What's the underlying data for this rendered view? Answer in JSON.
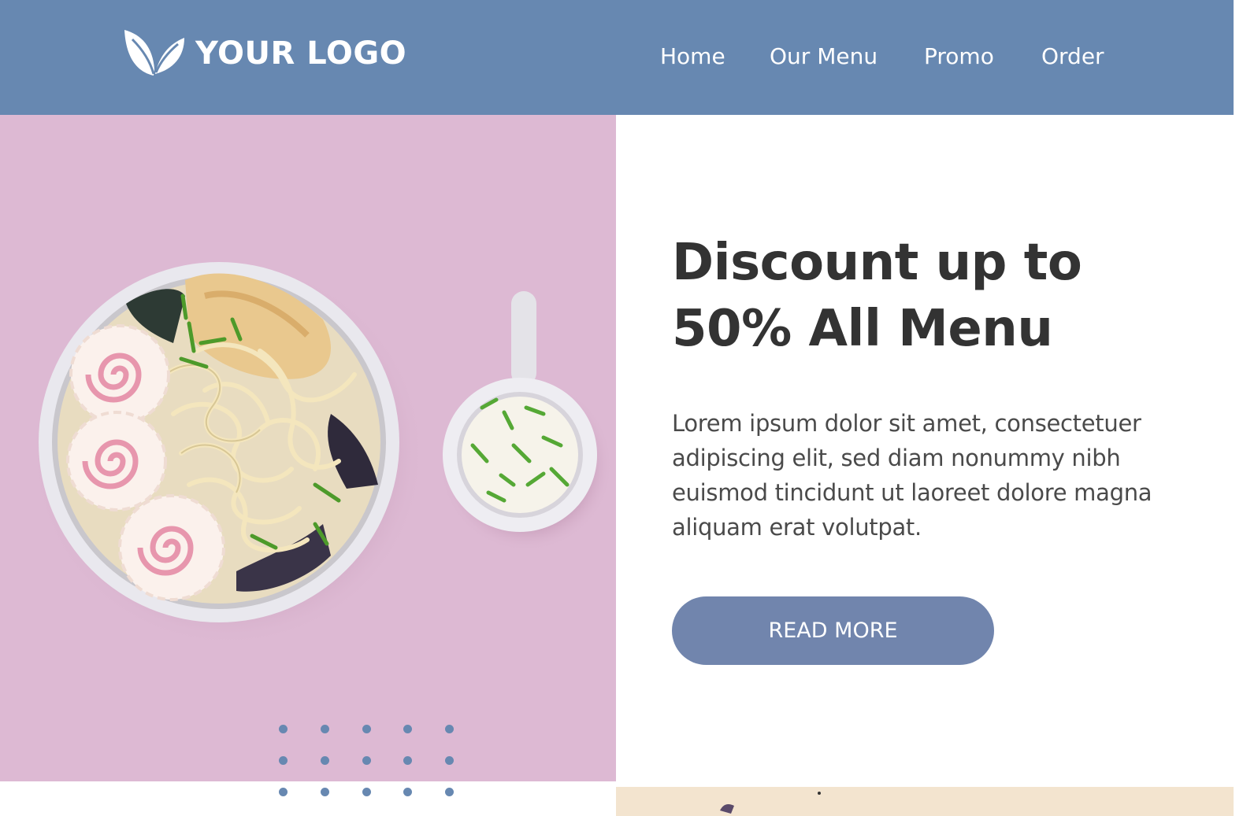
{
  "header": {
    "logo_text": "YOUR LOGO",
    "nav": [
      "Home",
      "Our Menu",
      "Promo",
      "Order"
    ]
  },
  "hero": {
    "headline_line1": "Discount up to",
    "headline_line2": "50% All Menu",
    "body": "Lorem ipsum dolor sit amet, consectetuer adipiscing elit, sed diam nonummy nibh euismod tincidunt ut laoreet dolore magna aliquam erat volutpat.",
    "cta_label": "READ MORE"
  },
  "colors": {
    "header_bg": "#6788b1",
    "image_bg": "#ddb9d3",
    "button_bg": "#7185ad",
    "headline": "#333333"
  },
  "icons": {
    "logo": "leaf-logo-icon"
  }
}
